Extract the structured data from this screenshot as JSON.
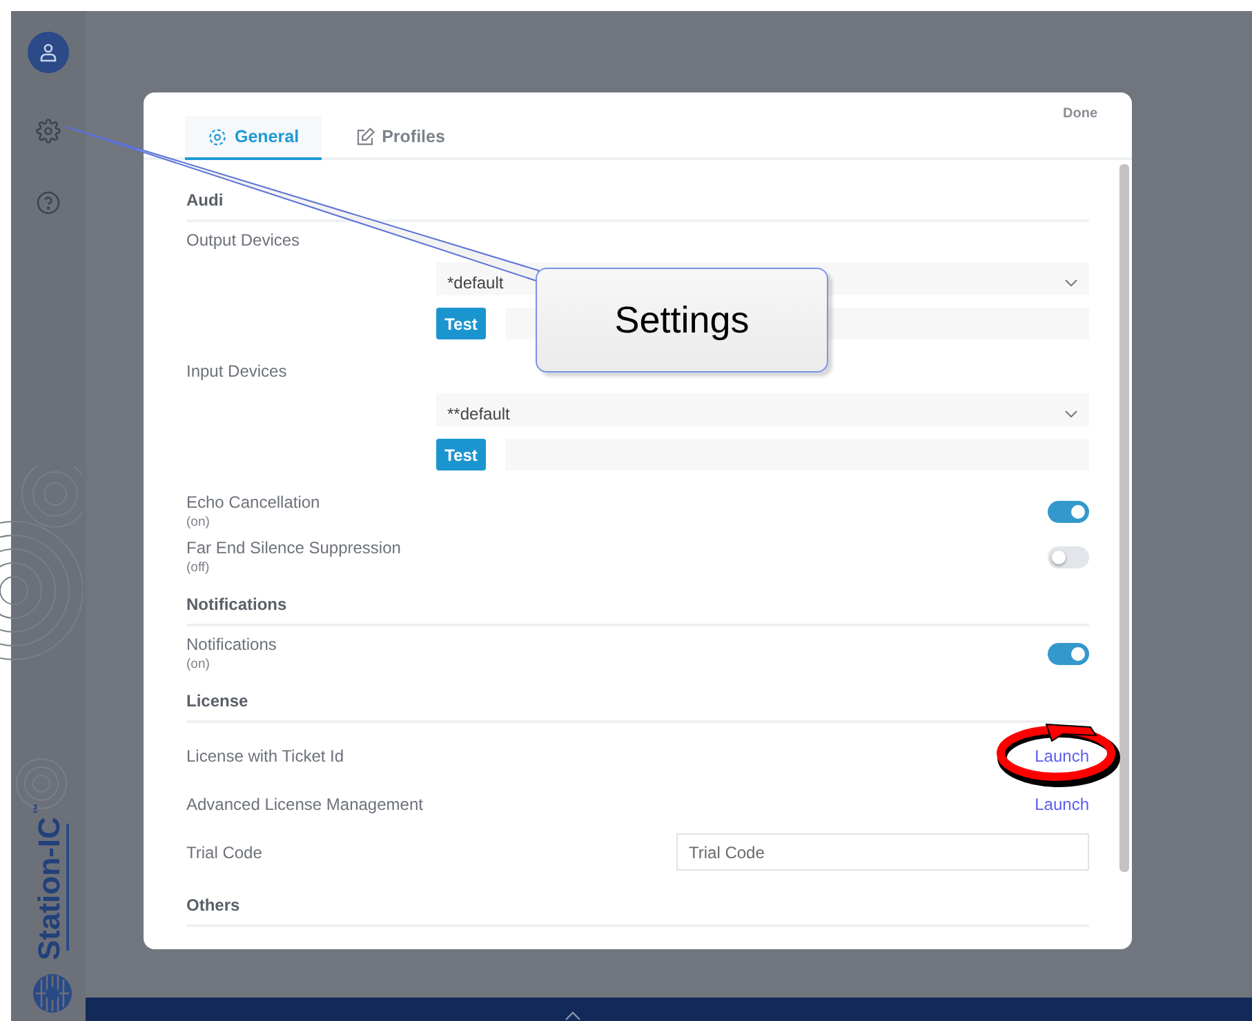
{
  "sidebar": {
    "logo": {
      "name": "Station-IC",
      "mark": "™"
    }
  },
  "dialog": {
    "tabs": [
      {
        "label": "General",
        "selected": true
      },
      {
        "label": "Profiles",
        "selected": false
      }
    ],
    "done": "Done",
    "sections": [
      {
        "heading": "Audi",
        "items": [
          {
            "kind": "device",
            "label": "Output Devices",
            "select": "*default",
            "button": "Test"
          },
          {
            "kind": "device",
            "label": "Input Devices",
            "select": "**default",
            "button": "Test"
          },
          {
            "kind": "toggle",
            "label": "Echo Cancellation",
            "status": "(on)",
            "on": true
          },
          {
            "kind": "toggle",
            "label": "Far End Silence Suppression",
            "status": "(off)",
            "on": false
          }
        ]
      },
      {
        "heading": "Notifications",
        "items": [
          {
            "kind": "toggle",
            "label": "Notifications",
            "status": "(on)",
            "on": true
          }
        ]
      },
      {
        "heading": "License",
        "items": [
          {
            "kind": "link",
            "label": "License with Ticket Id",
            "link": "Launch",
            "circled": true
          },
          {
            "kind": "link",
            "label": "Advanced License Management",
            "link": "Launch",
            "circled": false
          },
          {
            "kind": "input",
            "label": "Trial Code",
            "placeholder": "Trial Code"
          }
        ]
      },
      {
        "heading": "Others"
      }
    ]
  },
  "annotation": {
    "callout": "Settings"
  }
}
